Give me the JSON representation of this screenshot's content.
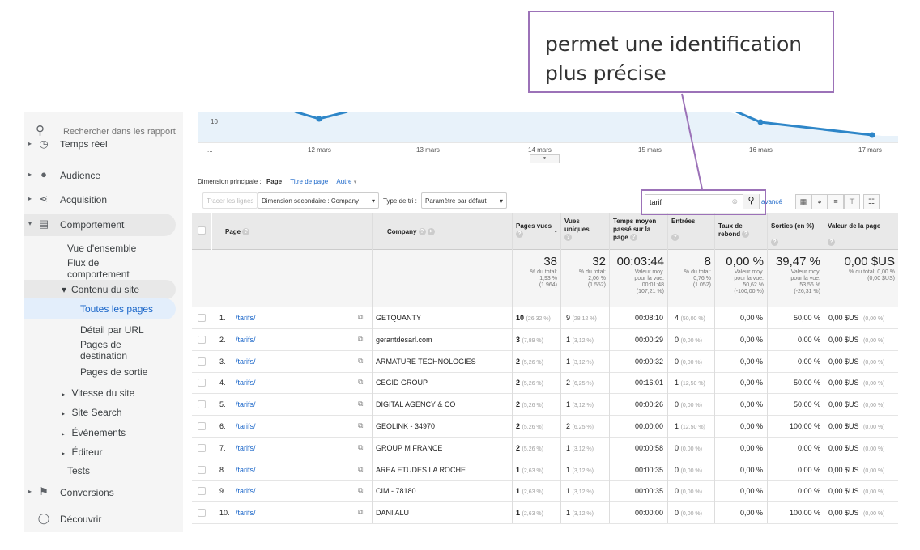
{
  "annotation": {
    "line1": "permet une identification",
    "line2": "plus précise"
  },
  "sidebar": {
    "search_placeholder": "Rechercher dans les rapport",
    "items": [
      {
        "label": "Temps réel"
      },
      {
        "label": "Audience"
      },
      {
        "label": "Acquisition"
      },
      {
        "label": "Comportement"
      },
      {
        "label": "Conversions"
      },
      {
        "label": "Découvrir"
      }
    ],
    "comportement_sub": {
      "vue": "Vue d'ensemble",
      "flux1": "Flux de",
      "flux2": "comportement",
      "contenu": "Contenu du site",
      "toutes": "Toutes les pages",
      "detail": "Détail par URL",
      "dest1": "Pages de",
      "dest2": "destination",
      "sortie": "Pages de sortie",
      "vitesse": "Vitesse du site",
      "search": "Site Search",
      "events": "Événements",
      "editeur": "Éditeur",
      "tests": "Tests"
    }
  },
  "chart": {
    "y_tick": "10",
    "x_ticks": [
      "...",
      "12 mars",
      "13 mars",
      "14 mars",
      "15 mars",
      "16 mars",
      "17 mars"
    ],
    "line_color": "#2e86c8"
  },
  "controls": {
    "dim_label": "Dimension principale :",
    "dim_page": "Page",
    "dim_title": "Titre de page",
    "dim_other": "Autre",
    "plot_rows": "Tracer les lignes",
    "secondary": "Dimension secondaire : Company",
    "sort_label": "Type de tri :",
    "sort_value": "Paramètre par défaut",
    "search_value": "tarif",
    "advanced": "avancé"
  },
  "table": {
    "headers": {
      "page": "Page",
      "company": "Company",
      "views": "Pages vues",
      "unique": "Vues uniques",
      "time1": "Temps moyen",
      "time2": "passé sur la",
      "time3": "page",
      "entries": "Entrées",
      "bounce1": "Taux de",
      "bounce2": "rebond",
      "exits": "Sorties (en %)",
      "value": "Valeur de la page"
    },
    "totals": {
      "views": {
        "big": "38",
        "l1": "% du total:",
        "l2": "1,93 %",
        "l3": "(1 964)"
      },
      "unique": {
        "big": "32",
        "l1": "% du total:",
        "l2": "2,06 %",
        "l3": "(1 552)"
      },
      "time": {
        "big": "00:03:44",
        "l1": "Valeur moy.",
        "l2": "pour la vue:",
        "l3": "00:01:48",
        "l4": "(107,21 %)"
      },
      "entries": {
        "big": "8",
        "l1": "% du total:",
        "l2": "0,76 %",
        "l3": "(1 052)"
      },
      "bounce": {
        "big": "0,00 %",
        "l1": "Valeur moy.",
        "l2": "pour la vue:",
        "l3": "50,62 %",
        "l4": "(-100,00 %)"
      },
      "exits": {
        "big": "39,47 %",
        "l1": "Valeur moy.",
        "l2": "pour la vue:",
        "l3": "53,56 %",
        "l4": "(-26,31 %)"
      },
      "value": {
        "big": "0,00 $US",
        "l1": "% du total: 0,00 %",
        "l2": "(0,00 $US)"
      }
    },
    "rows": [
      {
        "n": "1.",
        "page": "/tarifs/",
        "company": "GETQUANTY",
        "views": "10",
        "vp": "(26,32 %)",
        "uniq": "9",
        "up": "(28,12 %)",
        "time": "00:08:10",
        "ent": "4",
        "ep": "(50,00 %)",
        "bounce": "0,00 %",
        "exits": "50,00 %",
        "val": "0,00 $US",
        "valp": "(0,00 %)"
      },
      {
        "n": "2.",
        "page": "/tarifs/",
        "company": "gerantdesarl.com",
        "views": "3",
        "vp": "(7,89 %)",
        "uniq": "1",
        "up": "(3,12 %)",
        "time": "00:00:29",
        "ent": "0",
        "ep": "(0,00 %)",
        "bounce": "0,00 %",
        "exits": "0,00 %",
        "val": "0,00 $US",
        "valp": "(0,00 %)"
      },
      {
        "n": "3.",
        "page": "/tarifs/",
        "company": "ARMATURE TECHNOLOGIES",
        "views": "2",
        "vp": "(5,26 %)",
        "uniq": "1",
        "up": "(3,12 %)",
        "time": "00:00:32",
        "ent": "0",
        "ep": "(0,00 %)",
        "bounce": "0,00 %",
        "exits": "0,00 %",
        "val": "0,00 $US",
        "valp": "(0,00 %)"
      },
      {
        "n": "4.",
        "page": "/tarifs/",
        "company": "CEGID GROUP",
        "views": "2",
        "vp": "(5,26 %)",
        "uniq": "2",
        "up": "(6,25 %)",
        "time": "00:16:01",
        "ent": "1",
        "ep": "(12,50 %)",
        "bounce": "0,00 %",
        "exits": "50,00 %",
        "val": "0,00 $US",
        "valp": "(0,00 %)"
      },
      {
        "n": "5.",
        "page": "/tarifs/",
        "company": "DIGITAL AGENCY & CO",
        "views": "2",
        "vp": "(5,26 %)",
        "uniq": "1",
        "up": "(3,12 %)",
        "time": "00:00:26",
        "ent": "0",
        "ep": "(0,00 %)",
        "bounce": "0,00 %",
        "exits": "50,00 %",
        "val": "0,00 $US",
        "valp": "(0,00 %)"
      },
      {
        "n": "6.",
        "page": "/tarifs/",
        "company": "GEOLINK - 34970",
        "views": "2",
        "vp": "(5,26 %)",
        "uniq": "2",
        "up": "(6,25 %)",
        "time": "00:00:00",
        "ent": "1",
        "ep": "(12,50 %)",
        "bounce": "0,00 %",
        "exits": "100,00 %",
        "val": "0,00 $US",
        "valp": "(0,00 %)"
      },
      {
        "n": "7.",
        "page": "/tarifs/",
        "company": "GROUP M FRANCE",
        "views": "2",
        "vp": "(5,26 %)",
        "uniq": "1",
        "up": "(3,12 %)",
        "time": "00:00:58",
        "ent": "0",
        "ep": "(0,00 %)",
        "bounce": "0,00 %",
        "exits": "0,00 %",
        "val": "0,00 $US",
        "valp": "(0,00 %)"
      },
      {
        "n": "8.",
        "page": "/tarifs/",
        "company": "AREA ETUDES LA ROCHE",
        "views": "1",
        "vp": "(2,63 %)",
        "uniq": "1",
        "up": "(3,12 %)",
        "time": "00:00:35",
        "ent": "0",
        "ep": "(0,00 %)",
        "bounce": "0,00 %",
        "exits": "0,00 %",
        "val": "0,00 $US",
        "valp": "(0,00 %)"
      },
      {
        "n": "9.",
        "page": "/tarifs/",
        "company": "CIM - 78180",
        "views": "1",
        "vp": "(2,63 %)",
        "uniq": "1",
        "up": "(3,12 %)",
        "time": "00:00:35",
        "ent": "0",
        "ep": "(0,00 %)",
        "bounce": "0,00 %",
        "exits": "0,00 %",
        "val": "0,00 $US",
        "valp": "(0,00 %)"
      },
      {
        "n": "10.",
        "page": "/tarifs/",
        "company": "DANI ALU",
        "views": "1",
        "vp": "(2,63 %)",
        "uniq": "1",
        "up": "(3,12 %)",
        "time": "00:00:00",
        "ent": "0",
        "ep": "(0,00 %)",
        "bounce": "0,00 %",
        "exits": "100,00 %",
        "val": "0,00 $US",
        "valp": "(0,00 %)"
      }
    ]
  }
}
